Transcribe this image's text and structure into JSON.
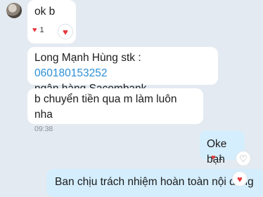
{
  "messages": [
    {
      "text": "ok b",
      "reaction_count": "1"
    },
    {
      "line1_prefix": "Long Mạnh Hùng stk : ",
      "line1_link": "060180153252",
      "line2": "ngân hàng Sacombank ."
    },
    {
      "text": "b chuyển tiền qua m làm luôn nha",
      "time": "09:38"
    },
    {
      "text": "Oke bạn",
      "reaction_count": "1"
    },
    {
      "text": "Ban chịu trách nhiệm hoàn toàn nội dung"
    }
  ],
  "icons": {
    "heart": "♥",
    "heart_outline": "♡"
  },
  "colors": {
    "background": "#e3eaf1",
    "incoming_bubble": "#ffffff",
    "outgoing_bubble": "#d5eefd",
    "link": "#2b8fd6",
    "heart": "#e5383f"
  }
}
